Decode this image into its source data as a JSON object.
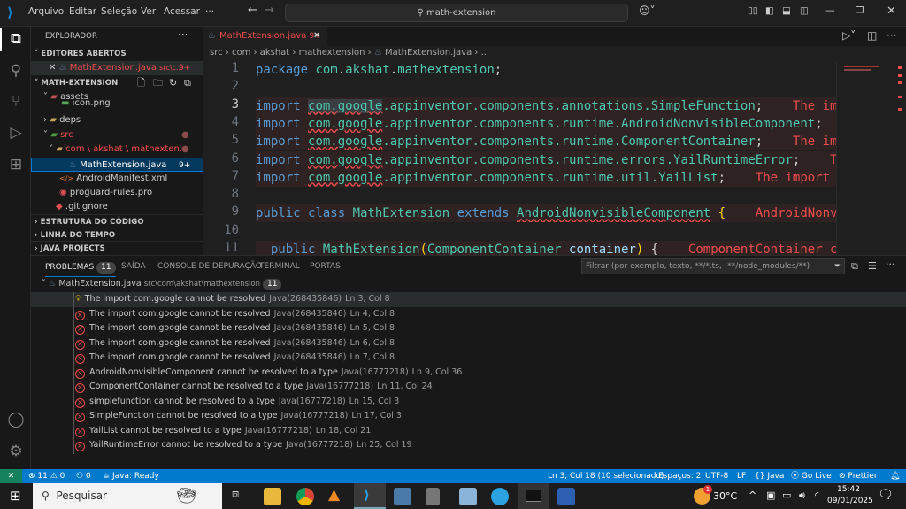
{
  "titlebar": {
    "menu": [
      "Arquivo",
      "Editar",
      "Seleção",
      "Ver",
      "Acessar",
      "···"
    ],
    "search": "math-extension"
  },
  "sidebar": {
    "title": "EXPLORADOR",
    "open_editors": "EDITORES ABERTOS",
    "open_file": "MathExtension.java",
    "open_file_path": "src\\c...",
    "open_file_badge": "9+",
    "project": "MATH-EXTENSION",
    "tree": [
      {
        "label": "assets",
        "kind": "folder-open"
      },
      {
        "label": "icon.png",
        "kind": "image"
      },
      {
        "label": "deps",
        "kind": "folder"
      },
      {
        "label": "src",
        "kind": "folder-open"
      },
      {
        "label": "com \\ akshat \\ mathexten...",
        "kind": "folder-open"
      },
      {
        "label": "MathExtension.java",
        "kind": "java",
        "badge": "9+"
      },
      {
        "label": "AndroidManifest.xml",
        "kind": "xml"
      },
      {
        "label": "proguard-rules.pro",
        "kind": "pro"
      },
      {
        "label": ".gitignore",
        "kind": "git"
      }
    ],
    "sections": [
      "ESTRUTURA DO CÓDIGO",
      "LINHA DO TEMPO",
      "JAVA PROJECTS"
    ]
  },
  "editor": {
    "tab": "MathExtension.java",
    "tab_badge": "9+",
    "breadcrumb": [
      "src",
      "com",
      "akshat",
      "mathextension",
      "MathExtension.java",
      "..."
    ],
    "lines": [
      {
        "n": "1",
        "err": false,
        "seg": [
          [
            "package ",
            "kw"
          ],
          [
            "com",
            "ty"
          ],
          [
            ".",
            "pl"
          ],
          [
            "akshat",
            "ty"
          ],
          [
            ".",
            "pl"
          ],
          [
            "mathextension",
            "ty"
          ],
          [
            ";",
            "pl"
          ]
        ]
      },
      {
        "n": "2",
        "err": false,
        "seg": []
      },
      {
        "n": "3",
        "err": true,
        "seg": [
          [
            "import ",
            "kw"
          ],
          [
            "com.google",
            "ty sq"
          ],
          [
            ".appinventor.components.annotations.SimpleFunction",
            "ty"
          ],
          [
            ";",
            "pl"
          ],
          [
            "    The import com.google cannot be resolved",
            "er"
          ]
        ]
      },
      {
        "n": "4",
        "err": true,
        "seg": [
          [
            "import ",
            "kw"
          ],
          [
            "com.google",
            "ty sq"
          ],
          [
            ".appinventor.components.runtime.AndroidNonvisibleComponent",
            "ty"
          ],
          [
            ";",
            "pl"
          ]
        ]
      },
      {
        "n": "5",
        "err": true,
        "seg": [
          [
            "import ",
            "kw"
          ],
          [
            "com.google",
            "ty sq"
          ],
          [
            ".appinventor.components.runtime.ComponentContainer",
            "ty"
          ],
          [
            ";",
            "pl"
          ],
          [
            "    The import com.google cannot be resolved",
            "er"
          ]
        ]
      },
      {
        "n": "6",
        "err": true,
        "seg": [
          [
            "import ",
            "kw"
          ],
          [
            "com.google",
            "ty sq"
          ],
          [
            ".appinventor.components.runtime.errors.YailRuntimeError",
            "ty"
          ],
          [
            ";",
            "pl"
          ],
          [
            "    The import com.google cannot be resolved",
            "er"
          ]
        ]
      },
      {
        "n": "7",
        "err": true,
        "seg": [
          [
            "import ",
            "kw"
          ],
          [
            "com.google",
            "ty sq"
          ],
          [
            ".appinventor.components.runtime.util.YailList",
            "ty"
          ],
          [
            ";",
            "pl"
          ],
          [
            "    The import com.google cannot be resolved",
            "er"
          ]
        ]
      },
      {
        "n": "8",
        "err": false,
        "seg": []
      },
      {
        "n": "9",
        "err": true,
        "seg": [
          [
            "public class ",
            "kw"
          ],
          [
            "MathExtension ",
            "ty"
          ],
          [
            "extends ",
            "kw"
          ],
          [
            "AndroidNonvisibleComponent",
            "ty sq"
          ],
          [
            " ",
            "pl"
          ],
          [
            "{",
            "br"
          ],
          [
            "    AndroidNonvisibleComponent cannot be resolved to a type",
            "er"
          ]
        ]
      },
      {
        "n": "10",
        "err": false,
        "seg": []
      },
      {
        "n": "11",
        "err": true,
        "seg": [
          [
            "  public ",
            "kw"
          ],
          [
            "MathExtension",
            "ty"
          ],
          [
            "(",
            "br"
          ],
          [
            "ComponentContainer",
            "ty sq"
          ],
          [
            " container",
            "id"
          ],
          [
            ")",
            "br"
          ],
          [
            " {",
            "pl"
          ],
          [
            "    ComponentContainer cannot be resolved to a type",
            "er"
          ]
        ]
      }
    ]
  },
  "panel": {
    "tabs": [
      "PROBLEMAS",
      "SAÍDA",
      "CONSOLE DE DEPURAÇÃO",
      "TERMINAL",
      "PORTAS"
    ],
    "count": "11",
    "filter_placeholder": "Filtrar (por exemplo, texto, **/*.ts, !**/node_modules/**)",
    "file": "MathExtension.java",
    "file_path": "src\\com\\akshat\\mathextension",
    "file_count": "11",
    "problems": [
      {
        "icon": "lightbulb",
        "msg": "The import com.google cannot be resolved",
        "src": "Java(268435846)",
        "loc": "Ln 3, Col 8"
      },
      {
        "icon": "error",
        "msg": "The import com.google cannot be resolved",
        "src": "Java(268435846)",
        "loc": "Ln 4, Col 8"
      },
      {
        "icon": "error",
        "msg": "The import com.google cannot be resolved",
        "src": "Java(268435846)",
        "loc": "Ln 5, Col 8"
      },
      {
        "icon": "error",
        "msg": "The import com.google cannot be resolved",
        "src": "Java(268435846)",
        "loc": "Ln 6, Col 8"
      },
      {
        "icon": "error",
        "msg": "The import com.google cannot be resolved",
        "src": "Java(268435846)",
        "loc": "Ln 7, Col 8"
      },
      {
        "icon": "error",
        "msg": "AndroidNonvisibleComponent cannot be resolved to a type",
        "src": "Java(16777218)",
        "loc": "Ln 9, Col 36"
      },
      {
        "icon": "error",
        "msg": "ComponentContainer cannot be resolved to a type",
        "src": "Java(16777218)",
        "loc": "Ln 11, Col 24"
      },
      {
        "icon": "error",
        "msg": "simplefunction cannot be resolved to a type",
        "src": "Java(16777218)",
        "loc": "Ln 15, Col 3"
      },
      {
        "icon": "error",
        "msg": "SimpleFunction cannot be resolved to a type",
        "src": "Java(16777218)",
        "loc": "Ln 17, Col 3"
      },
      {
        "icon": "error",
        "msg": "YailList cannot be resolved to a type",
        "src": "Java(16777218)",
        "loc": "Ln 18, Col 21"
      },
      {
        "icon": "error",
        "msg": "YailRuntimeError cannot be resolved to a type",
        "src": "Java(16777218)",
        "loc": "Ln 25, Col 19"
      }
    ]
  },
  "status": {
    "errors": "11",
    "warnings": "0",
    "ports": "0",
    "java": "Java: Ready",
    "cursor": "Ln 3, Col 18 (10 selecionado)",
    "spaces": "Espaços: 2",
    "encoding": "UTF-8",
    "eol": "LF",
    "lang": "Java",
    "golive": "Go Live",
    "prettier": "Prettier"
  },
  "taskbar": {
    "search": "Pesquisar",
    "weather": "30°C",
    "weather_badge": "1",
    "time": "15:42",
    "date": "09/01/2025"
  },
  "colors": {
    "accent": "#007acc",
    "error": "#f14c4c",
    "remote": "#16825d"
  }
}
